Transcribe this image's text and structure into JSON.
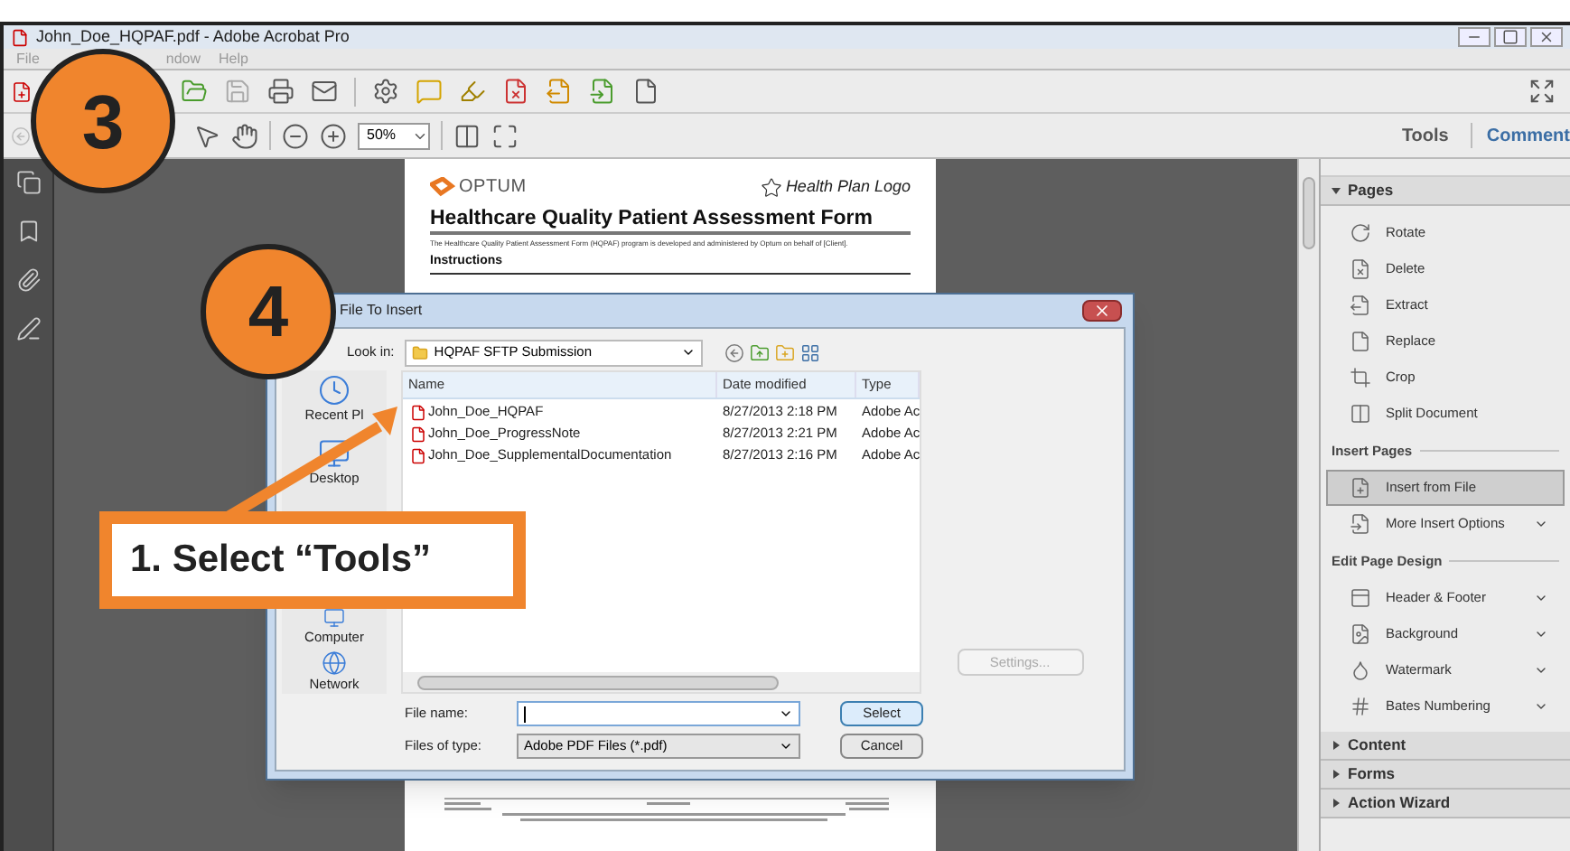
{
  "window": {
    "title": "John_Doe_HQPAF.pdf - Adobe Acrobat Pro"
  },
  "menu": [
    "File",
    "ndow",
    "Help"
  ],
  "toolbar": {
    "zoom": "50%",
    "panel_tabs": [
      {
        "label": "Tools",
        "selected": true
      },
      {
        "label": "Comment",
        "selected": false
      }
    ]
  },
  "document": {
    "logo": "OPTUM",
    "health_plan_logo": "Health Plan Logo",
    "title": "Healthcare Quality Patient Assessment Form",
    "intro": "The Healthcare Quality Patient Assessment Form (HQPAF) program is developed and administered by Optum on behalf of [Client].",
    "section": "Instructions"
  },
  "tools_panel": {
    "sections": [
      {
        "title": "Pages",
        "expanded": true,
        "items": [
          {
            "kind": "tool",
            "label": "Rotate",
            "selected": false,
            "has_menu": false
          },
          {
            "kind": "tool",
            "label": "Delete",
            "selected": false,
            "has_menu": false
          },
          {
            "kind": "tool",
            "label": "Extract",
            "selected": false,
            "has_menu": false
          },
          {
            "kind": "tool",
            "label": "Replace",
            "selected": false,
            "has_menu": false
          },
          {
            "kind": "tool",
            "label": "Crop",
            "selected": false,
            "has_menu": false
          },
          {
            "kind": "tool",
            "label": "Split Document",
            "selected": false,
            "has_menu": false
          },
          {
            "kind": "heading",
            "label": "Insert Pages"
          },
          {
            "kind": "tool",
            "label": "Insert from File",
            "selected": true,
            "has_menu": false
          },
          {
            "kind": "tool",
            "label": "More Insert Options",
            "selected": false,
            "has_menu": true
          },
          {
            "kind": "heading",
            "label": "Edit Page Design"
          },
          {
            "kind": "tool",
            "label": "Header & Footer",
            "selected": false,
            "has_menu": true
          },
          {
            "kind": "tool",
            "label": "Background",
            "selected": false,
            "has_menu": true
          },
          {
            "kind": "tool",
            "label": "Watermark",
            "selected": false,
            "has_menu": true
          },
          {
            "kind": "tool",
            "label": "Bates Numbering",
            "selected": false,
            "has_menu": true
          }
        ]
      },
      {
        "title": "Content",
        "expanded": false
      },
      {
        "title": "Forms",
        "expanded": false
      },
      {
        "title": "Action Wizard",
        "expanded": false
      }
    ]
  },
  "dialog": {
    "title": "File To Insert",
    "look_in_label": "Look in:",
    "look_in": "HQPAF SFTP Submission",
    "places": [
      "Recent Pl",
      "Desktop",
      "Computer",
      "Network"
    ],
    "columns": [
      "Name",
      "Date modified",
      "Type"
    ],
    "files": [
      {
        "name": "John_Doe_HQPAF",
        "date": "8/27/2013 2:18 PM",
        "type": "Adobe Ac"
      },
      {
        "name": "John_Doe_ProgressNote",
        "date": "8/27/2013 2:21 PM",
        "type": "Adobe Ac"
      },
      {
        "name": "John_Doe_SupplementalDocumentation",
        "date": "8/27/2013 2:16 PM",
        "type": "Adobe Ac"
      }
    ],
    "settings_button": {
      "label": "Settings...",
      "disabled": true
    },
    "file_name_label": "File name:",
    "files_of_type_label": "Files of type:",
    "files_of_type": "Adobe PDF Files (*.pdf)",
    "buttons": [
      {
        "label": "Select",
        "default": true
      },
      {
        "label": "Cancel",
        "default": false
      }
    ]
  },
  "callouts": [
    "3",
    "4"
  ],
  "instruction": "1. Select “Tools”"
}
